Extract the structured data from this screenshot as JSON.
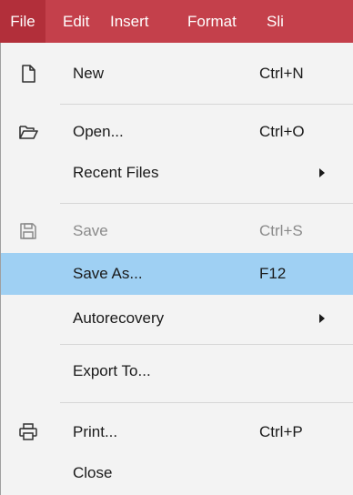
{
  "menubar": {
    "items": [
      {
        "label": "File"
      },
      {
        "label": "Edit"
      },
      {
        "label": "Insert"
      },
      {
        "label": "Format"
      },
      {
        "label": "Sli"
      }
    ],
    "color": "#c4404b"
  },
  "file_menu": {
    "highlight_color": "#9fd0f3",
    "items": [
      {
        "label": "New",
        "shortcut": "Ctrl+N",
        "icon": "new-document-icon"
      },
      {
        "label": "Open...",
        "shortcut": "Ctrl+O",
        "icon": "folder-open-icon"
      },
      {
        "label": "Recent Files",
        "submenu": true
      },
      {
        "label": "Save",
        "shortcut": "Ctrl+S",
        "icon": "save-icon",
        "disabled": true
      },
      {
        "label": "Save As...",
        "shortcut": "F12",
        "highlighted": true
      },
      {
        "label": "Autorecovery",
        "submenu": true
      },
      {
        "label": "Export To..."
      },
      {
        "label": "Print...",
        "shortcut": "Ctrl+P",
        "icon": "printer-icon"
      },
      {
        "label": "Close"
      }
    ]
  }
}
